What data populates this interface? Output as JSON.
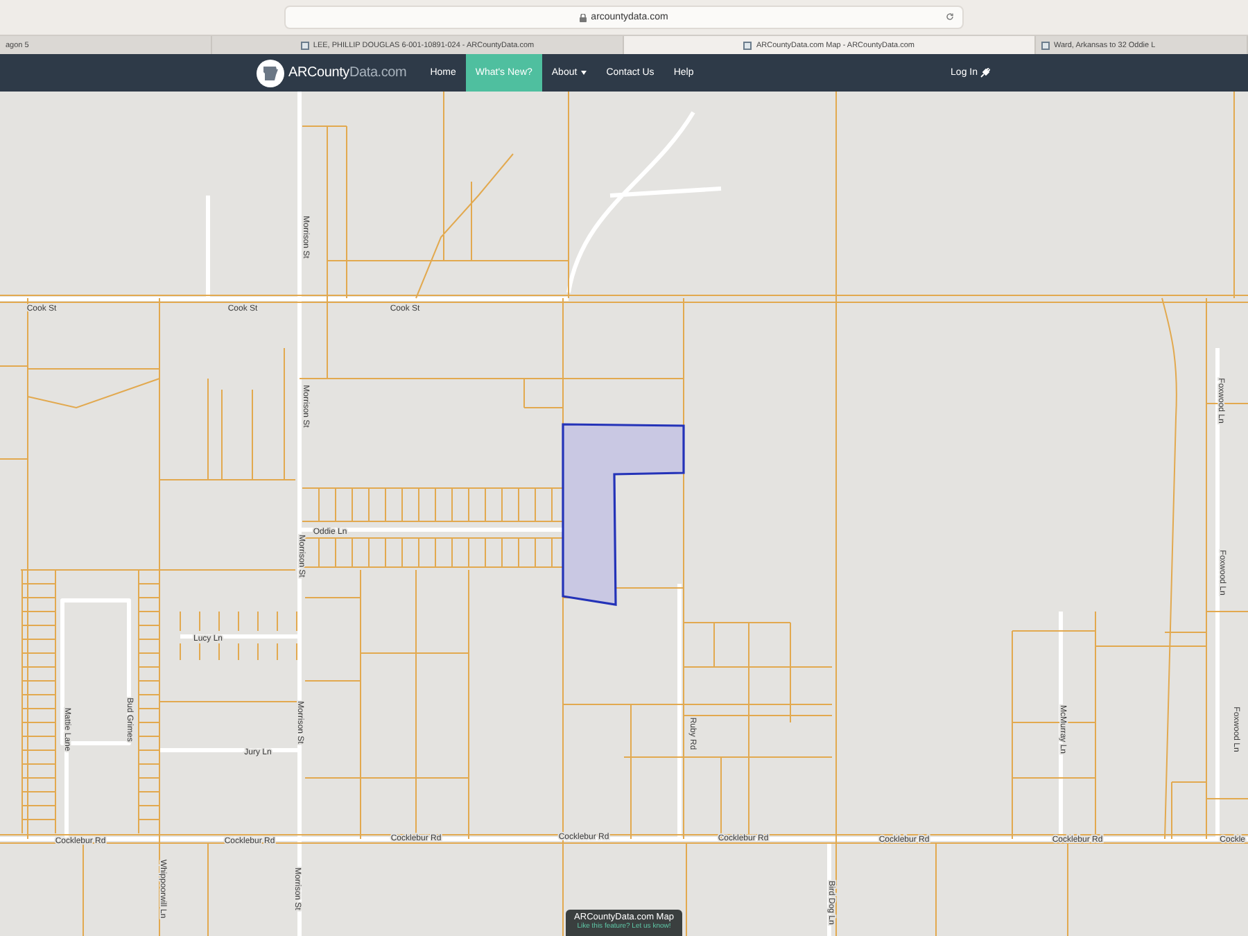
{
  "browser": {
    "address": "arcountydata.com",
    "tabs": [
      {
        "title": "agon 5",
        "selected": false,
        "favicon": false
      },
      {
        "title": "LEE, PHILLIP DOUGLAS 6-001-10891-024 - ARCountyData.com",
        "selected": false,
        "favicon": true
      },
      {
        "title": "ARCountyData.com Map - ARCountyData.com",
        "selected": true,
        "favicon": true
      },
      {
        "title": "Ward, Arkansas to 32 Oddie L",
        "selected": false,
        "favicon": true
      }
    ]
  },
  "navbar": {
    "logo": {
      "main": "ARCounty",
      "accent": "Data.com"
    },
    "items": [
      {
        "label": "Home",
        "selected": false,
        "kind": "link"
      },
      {
        "label": "What's New?",
        "selected": true,
        "kind": "link"
      },
      {
        "label": "About",
        "selected": false,
        "kind": "dropdown"
      },
      {
        "label": "Contact Us",
        "selected": false,
        "kind": "link"
      },
      {
        "label": "Help",
        "selected": false,
        "kind": "link"
      }
    ],
    "login": "Log In"
  },
  "map": {
    "street_labels": [
      "Cook St",
      "Cook St",
      "Cook St",
      "Morrison St",
      "Morrison St",
      "Oddie Ln",
      "Morrison St",
      "Lucy Ln",
      "Mattie Lane",
      "Bud Grimes",
      "Jury Ln",
      "Morrison St",
      "Cocklebur Rd",
      "Cocklebur Rd",
      "Cocklebur Rd",
      "Cocklebur Rd",
      "Cocklebur Rd",
      "Cocklebur Rd",
      "Cocklebur Rd",
      "Cockle",
      "Ruby Rd",
      "McMurray Ln",
      "Foxwood Ln",
      "Foxwood Ln",
      "Foxwood Ln",
      "Whippoorwill Ln",
      "Morrison St",
      "Bird Dog Ln"
    ],
    "selected_parcel": true,
    "popup": {
      "title": "ARCountyData.com Map",
      "link": "Like this feature? Let us know!"
    }
  }
}
